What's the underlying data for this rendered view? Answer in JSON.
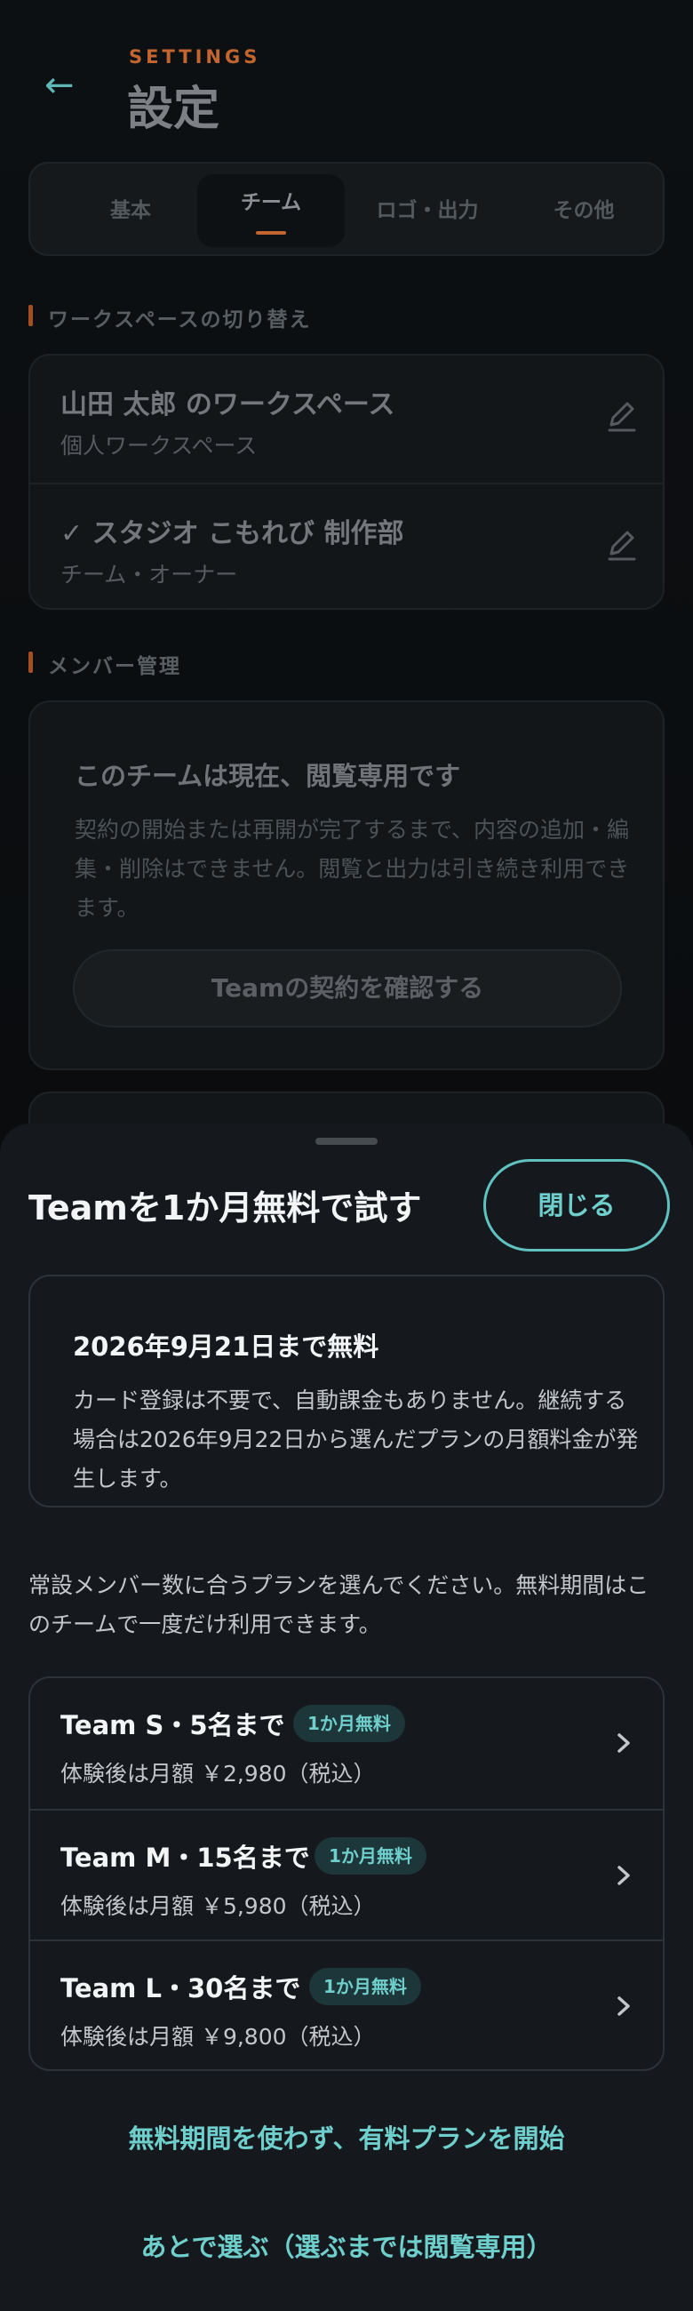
{
  "header": {
    "eyebrow": "SETTINGS",
    "title": "設定",
    "back_icon": "←"
  },
  "tabs": [
    {
      "label": "基本",
      "active": false
    },
    {
      "label": "チーム",
      "active": true
    },
    {
      "label": "ロゴ・出力",
      "active": false
    },
    {
      "label": "その他",
      "active": false
    }
  ],
  "workspace_section": {
    "label": "ワークスペースの切り替え",
    "items": [
      {
        "name": "山田 太郎 のワークスペース",
        "sub": "個人ワークスペース"
      },
      {
        "name": "✓ スタジオ こもれび 制作部",
        "sub": "チーム・オーナー"
      }
    ]
  },
  "member_section": {
    "label": "メンバー管理",
    "notice_title": "このチームは現在、閲覧専用です",
    "notice_body": "契約の開始または再開が完了するまで、内容の追加・編集・削除はできません。閲覧と出力は引き続き利用できます。",
    "notice_button": "Teamの契約を確認する"
  },
  "sheet": {
    "title": "Teamを1か月無料で試す",
    "close_label": "閉じる",
    "trial_title": "2026年9月21日まで無料",
    "trial_body": "カード登録は不要で、自動課金もありません。継続する場合は2026年9月22日から選んだプランの月額料金が発生します。",
    "description": "常設メンバー数に合うプランを選んでください。無料期間はこのチームで一度だけ利用できます。",
    "plans": [
      {
        "name": "Team S・5名まで",
        "badge": "1か月無料",
        "price": "体験後は月額 ￥2,980（税込）"
      },
      {
        "name": "Team M・15名まで",
        "badge": "1か月無料",
        "price": "体験後は月額 ￥5,980（税込）"
      },
      {
        "name": "Team L・30名まで",
        "badge": "1か月無料",
        "price": "体験後は月額 ￥9,800（税込）"
      }
    ],
    "paid_link": "無料期間を使わず、有料プランを開始",
    "later_link": "あとで選ぶ（選ぶまでは閲覧専用）"
  },
  "colors": {
    "accent": "#6fcfcc",
    "eyebrow": "#c2652f",
    "sheet_bg": "#15191d"
  }
}
